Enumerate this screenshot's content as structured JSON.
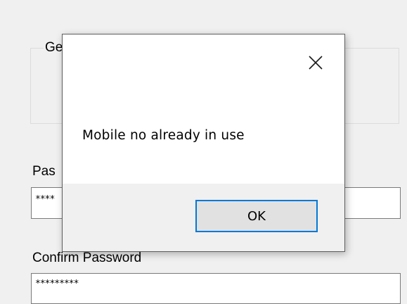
{
  "form": {
    "group_title": "Ge",
    "password_label": "Pas",
    "password_value": "****",
    "confirm_label": "Confirm Password",
    "confirm_value": "*********"
  },
  "dialog": {
    "message": "Mobile no already in use",
    "ok_label": "OK",
    "close_icon": "close-icon",
    "accent_color": "#0078d7"
  }
}
